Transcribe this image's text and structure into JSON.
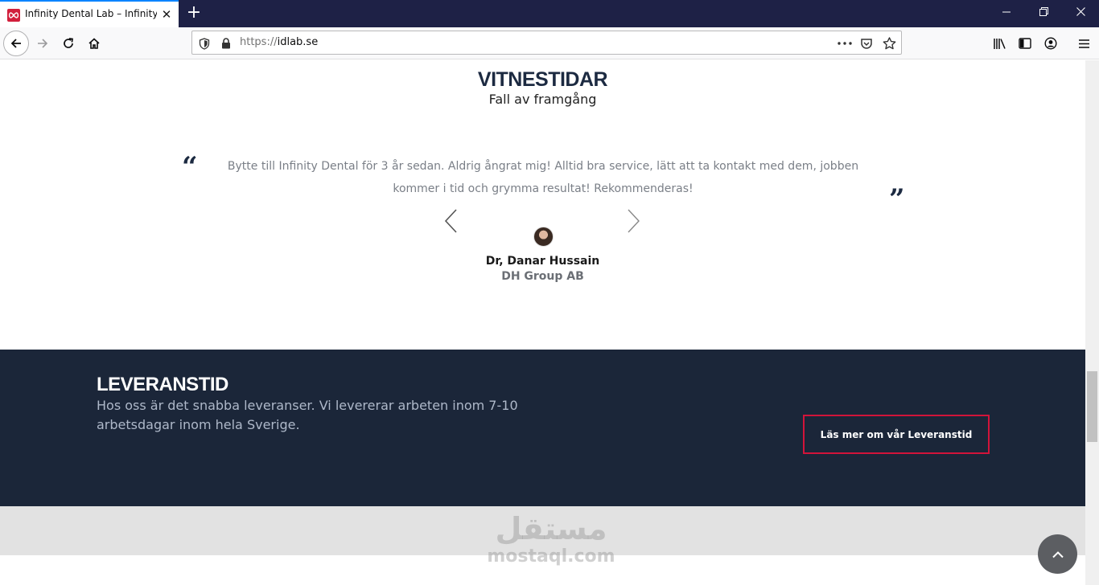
{
  "browser": {
    "tab_title": "Infinity Dental Lab – Infinity Dental Lab",
    "close_glyph": "✕",
    "newtab_glyph": "+",
    "url_scheme": "https://",
    "url_host": "idlab.se",
    "accent": "#0a84ff",
    "tabbar_color": "#1e2146"
  },
  "testimonials": {
    "title": "VITNESTIDAR",
    "subtitle": "Fall av framgång",
    "quote_open": "“",
    "quote_close": "”",
    "text": "Bytte till Infinity Dental för 3 år sedan. Aldrig ångrat mig! Alltid bra service, lätt att ta kontakt med dem, jobben kommer i tid och grymma resultat! Rekommenderas!",
    "name": "Dr, Danar Hussain",
    "company": "DH Group AB"
  },
  "delivery": {
    "title": "LEVERANSTID",
    "text": "Hos oss är det snabba leveranser. Vi levererar arbeten inom 7-10 arbetsdagar inom hela Sverige.",
    "button_label": "Läs mer om vår Leveranstid",
    "bg_color": "#1b2639",
    "button_border": "#d2143a"
  },
  "watermark": {
    "arabic": "مستقل",
    "latin": "mostaql.com"
  }
}
